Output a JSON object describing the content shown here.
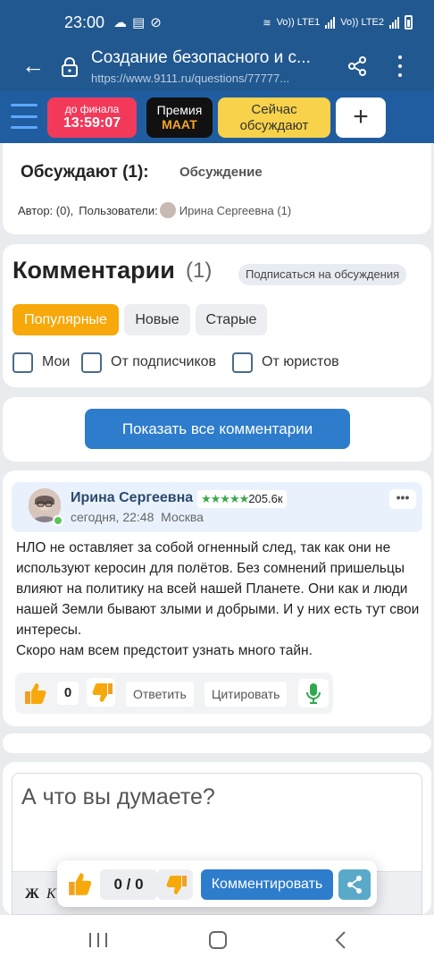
{
  "status_bar": {
    "time": "23:00",
    "sim1": "Vo)) LTE1",
    "sim2": "Vo)) LTE2"
  },
  "browser": {
    "title": "Создание безопасного и с...",
    "url": "https://www.9111.ru/questions/77777..."
  },
  "header": {
    "timer_label": "до финала",
    "timer_value": "13:59:07",
    "prize_label": "Премия",
    "prize_value": "МААТ",
    "now_label": "Сейчас обсуждают",
    "plus": "+"
  },
  "discussion": {
    "title": "Обсуждают (1):",
    "link": "Обсуждение",
    "author_label": "Автор: (0),",
    "users_label": "Пользователи:",
    "user": "Ирина Сергеевна (1)"
  },
  "comments": {
    "heading": "Комментарии",
    "count": "(1)",
    "subscribe": "Подписаться на обсуждения",
    "sort": [
      "Популярные",
      "Новые",
      "Старые"
    ],
    "filters": [
      "Мои",
      "От подписчиков",
      "От юристов"
    ],
    "show_all": "Показать все комментарии"
  },
  "comment": {
    "author": "Ирина Сергеевна",
    "stars": "★★★★★",
    "rating": "205.6к",
    "date": "сегодня, 22:48",
    "city": "Москва",
    "more": "•••",
    "body": [
      "НЛО не оставляет за собой огненный след, так как они не используют керосин для полётов. Без сомнений пришельцы влияют на политику на всей нашей Планете. Они как и люди нашей Земли бывают злыми и добрыми. И у них есть тут свои интересы.",
      "Скоро нам всем предстоит узнать много тайн."
    ],
    "likes": "0",
    "reply": "Ответить",
    "quote": "Цитировать"
  },
  "editor": {
    "placeholder": "А что вы думаете?",
    "bold": "Ж",
    "italic": "К"
  },
  "float_bar": {
    "counter": "0 / 0",
    "comment_button": "Комментировать"
  },
  "colors": {
    "brand_blue": "#21588f",
    "accent_orange": "#f7a80a",
    "primary_button": "#2e7ccc",
    "timer_red": "#f2395a"
  }
}
